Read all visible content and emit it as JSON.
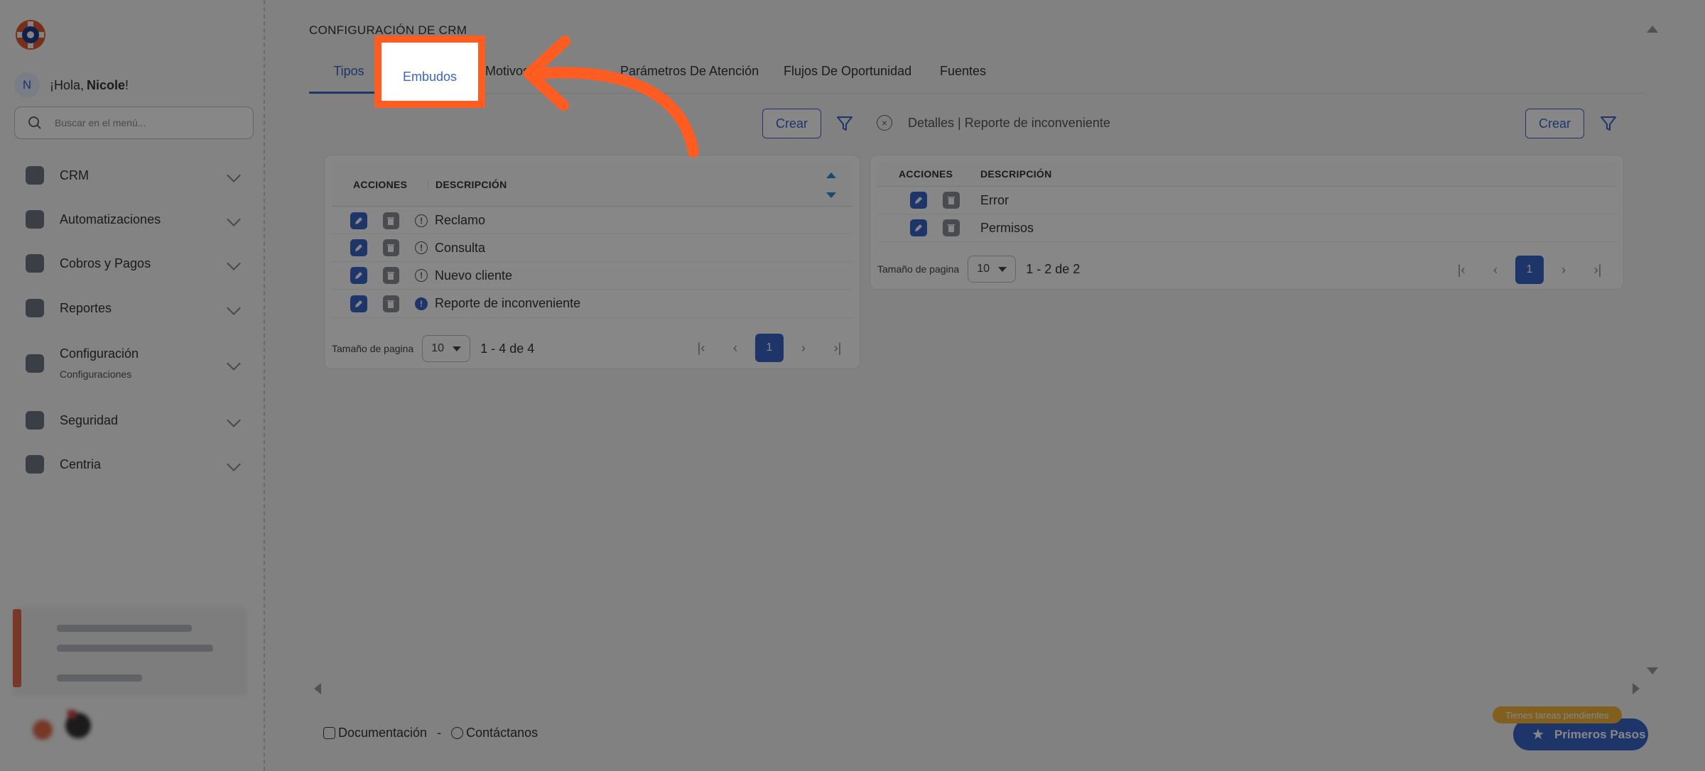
{
  "sidebar": {
    "greeting_prefix": "¡Hola,",
    "user_name": "Nicole",
    "greeting_suffix": "!",
    "user_initial": "N",
    "search_placeholder": "Buscar en el menú...",
    "items": [
      {
        "label": "CRM",
        "icon": "document-icon"
      },
      {
        "label": "Automatizaciones",
        "icon": "gear-icon"
      },
      {
        "label": "Cobros y Pagos",
        "icon": "id-card-icon"
      },
      {
        "label": "Reportes",
        "icon": "report-icon"
      },
      {
        "label": "Configuración",
        "sub": "Configuraciones",
        "icon": "book-icon"
      },
      {
        "label": "Seguridad",
        "icon": "shield-icon"
      },
      {
        "label": "Centria",
        "icon": "shield-icon"
      }
    ]
  },
  "main": {
    "title": "CONFIGURACIÓN DE CRM",
    "tabs": [
      "Tipos",
      "Embudos",
      "Motivos",
      "Parámetros De Atención",
      "Flujos De Oportunidad",
      "Fuentes"
    ],
    "active_tab": "Tipos",
    "create_label": "Crear",
    "details_label": "Detalles | Reporte de inconveniente"
  },
  "left_table": {
    "headers": [
      "ACCIONES",
      "DESCRIPCIÓN"
    ],
    "rows": [
      "Reclamo",
      "Consulta",
      "Nuevo cliente",
      "Reporte de inconveniente"
    ],
    "page_size_label": "Tamaño de pagina",
    "page_size": "10",
    "range": "1 - 4 de 4",
    "current_page": "1"
  },
  "right_table": {
    "headers": [
      "ACCIONES",
      "DESCRIPCIÓN"
    ],
    "rows": [
      "Error",
      "Permisos"
    ],
    "page_size_label": "Tamaño de pagina",
    "page_size": "10",
    "range": "1 - 2 de 2",
    "current_page": "1"
  },
  "footer": {
    "docs": "Documentación",
    "separator": "-",
    "contact": "Contáctanos"
  },
  "badge": {
    "pending": "Tienes tareas pendientes",
    "first_steps": "Primeros Pasos"
  },
  "colors": {
    "accent": "#3a64c9",
    "highlight": "#ff5c22",
    "pending": "#f4b43a"
  }
}
